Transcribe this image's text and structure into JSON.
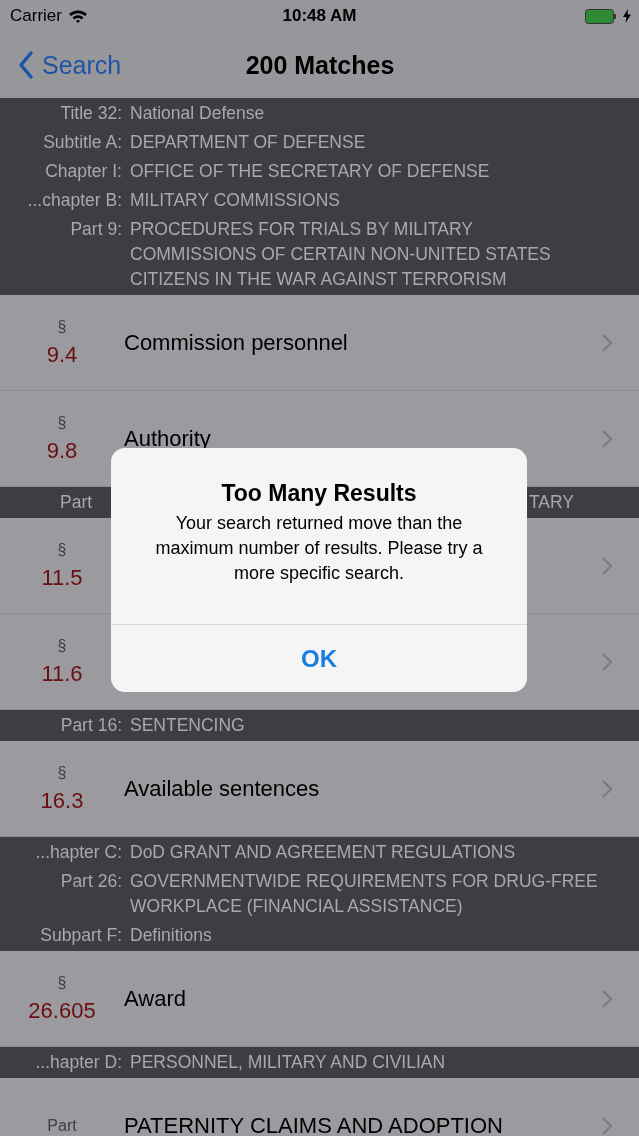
{
  "status_bar": {
    "carrier": "Carrier",
    "time": "10:48 AM",
    "charging": true
  },
  "nav": {
    "back": "Search",
    "title": "200 Matches"
  },
  "sections": [
    {
      "kind": "header",
      "entries": [
        {
          "label": "Title 32:",
          "value": "National Defense"
        },
        {
          "label": "Subtitle A:",
          "value": "DEPARTMENT OF DEFENSE"
        },
        {
          "label": "Chapter I:",
          "value": "OFFICE OF THE SECRETARY OF DEFENSE"
        },
        {
          "label": "...chapter B:",
          "value": "MILITARY COMMISSIONS"
        },
        {
          "label": "Part 9:",
          "value": "PROCEDURES FOR TRIALS BY MILITARY COMMISSIONS OF CERTAIN NON-UNITED STATES CITIZENS IN THE WAR AGAINST TERRORISM"
        }
      ]
    },
    {
      "kind": "row",
      "symbol": "§",
      "number": "9.4",
      "title": "Commission personnel"
    },
    {
      "kind": "row",
      "symbol": "§",
      "number": "9.8",
      "title": "Authority"
    },
    {
      "kind": "header",
      "entries": [
        {
          "label": "Part"
        }
      ],
      "tail": "TARY"
    },
    {
      "kind": "row",
      "symbol": "§",
      "number": "11.5"
    },
    {
      "kind": "row",
      "symbol": "§",
      "number": "11.6"
    },
    {
      "kind": "header",
      "entries": [
        {
          "label": "Part 16:",
          "value": "SENTENCING"
        }
      ]
    },
    {
      "kind": "row",
      "symbol": "§",
      "number": "16.3",
      "title": "Available sentences"
    },
    {
      "kind": "header",
      "entries": [
        {
          "label": "...hapter C:",
          "value": "DoD GRANT AND AGREEMENT REGULATIONS"
        },
        {
          "label": "Part 26:",
          "value": "GOVERNMENTWIDE REQUIREMENTS FOR DRUG-FREE WORKPLACE (FINANCIAL ASSISTANCE)"
        },
        {
          "label": "Subpart F:",
          "value": "Definitions"
        }
      ]
    },
    {
      "kind": "row",
      "symbol": "§",
      "number": "26.605",
      "title": "Award"
    },
    {
      "kind": "header",
      "entries": [
        {
          "label": "...hapter D:",
          "value": "PERSONNEL, MILITARY AND CIVILIAN"
        }
      ]
    },
    {
      "kind": "row",
      "symbol": "Part",
      "title": "PATERNITY CLAIMS AND ADOPTION"
    }
  ],
  "alert": {
    "title": "Too Many Results",
    "message": "Your search returned move than the maximum number of results. Please try a more specific search.",
    "button": "OK"
  }
}
